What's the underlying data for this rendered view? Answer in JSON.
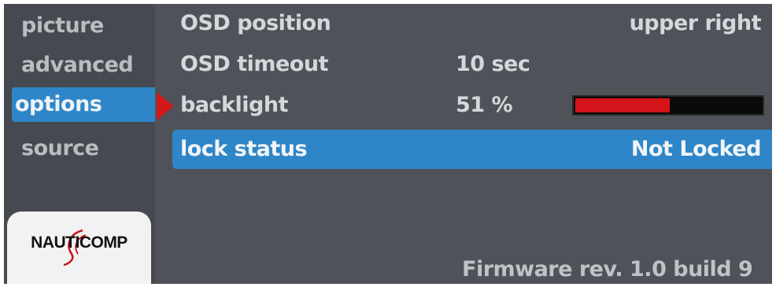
{
  "sidebar": {
    "items": [
      {
        "label": "picture"
      },
      {
        "label": "advanced"
      },
      {
        "label": "options"
      },
      {
        "label": "source"
      }
    ]
  },
  "menu": {
    "rows": [
      {
        "label": "OSD position",
        "value": "upper right"
      },
      {
        "label": "OSD timeout",
        "value": "10 sec"
      },
      {
        "label": "backlight",
        "value": "51 %",
        "level": 0.51
      },
      {
        "label": "lock status",
        "value": "Not Locked"
      }
    ]
  },
  "logo": {
    "text": "NAUTICOMP"
  },
  "footer": {
    "firmware": "Firmware rev. 1.0 build 9"
  },
  "colors": {
    "background": "#4f5359",
    "selection": "#2e86c8",
    "pointer": "#d01818",
    "bar_fill": "#d3141a"
  }
}
